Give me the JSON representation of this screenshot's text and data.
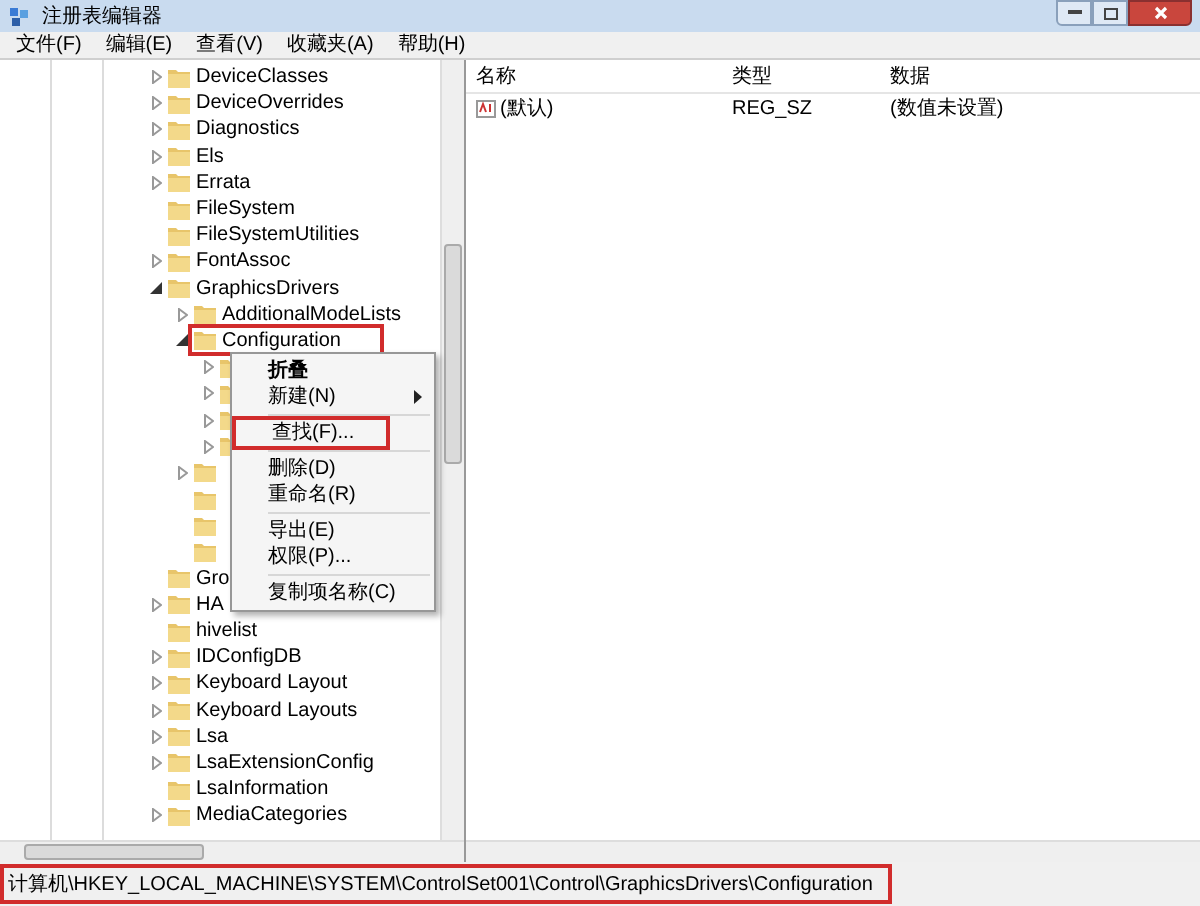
{
  "window": {
    "title": "注册表编辑器"
  },
  "menu_bar": [
    "文件(F)",
    "编辑(E)",
    "查看(V)",
    "收藏夹(A)",
    "帮助(H)"
  ],
  "tree": [
    {
      "label": "DeviceClasses",
      "expandable": true
    },
    {
      "label": "DeviceOverrides",
      "expandable": true
    },
    {
      "label": "Diagnostics",
      "expandable": true
    },
    {
      "label": "Els",
      "expandable": true
    },
    {
      "label": "Errata",
      "expandable": true
    },
    {
      "label": "FileSystem",
      "expandable": false
    },
    {
      "label": "FileSystemUtilities",
      "expandable": false
    },
    {
      "label": "FontAssoc",
      "expandable": true
    },
    {
      "label": "GraphicsDrivers",
      "expandable": true,
      "expanded": true,
      "children": [
        {
          "label": "AdditionalModeLists",
          "expandable": true
        },
        {
          "label": "Configuration",
          "expandable": true,
          "expanded": true,
          "highlighted": true,
          "children": [
            {
              "expandable": true
            },
            {
              "expandable": true
            },
            {
              "expandable": true
            },
            {
              "expandable": true
            }
          ]
        },
        {
          "expandable": true
        },
        {
          "expandable": false
        },
        {
          "expandable": false
        },
        {
          "expandable": false
        }
      ]
    },
    {
      "label": "Gro",
      "expandable": false
    },
    {
      "label": "HA",
      "expandable": true
    },
    {
      "label": "hivelist",
      "expandable": false
    },
    {
      "label": "IDConfigDB",
      "expandable": true
    },
    {
      "label": "Keyboard Layout",
      "expandable": true
    },
    {
      "label": "Keyboard Layouts",
      "expandable": true
    },
    {
      "label": "Lsa",
      "expandable": true
    },
    {
      "label": "LsaExtensionConfig",
      "expandable": true
    },
    {
      "label": "LsaInformation",
      "expandable": false
    },
    {
      "label": "MediaCategories",
      "expandable": true
    }
  ],
  "values": {
    "columns": [
      "名称",
      "类型",
      "数据"
    ],
    "rows": [
      {
        "name": "(默认)",
        "type": "REG_SZ",
        "data": "(数值未设置)"
      }
    ]
  },
  "context_menu": [
    {
      "kind": "item",
      "label": "折叠",
      "bold": true,
      "submenu": false,
      "highlighted": false
    },
    {
      "kind": "item",
      "label": "新建(N)",
      "bold": false,
      "submenu": true,
      "highlighted": false
    },
    {
      "kind": "separator"
    },
    {
      "kind": "item",
      "label": "查找(F)...",
      "bold": false,
      "submenu": false,
      "highlighted": true
    },
    {
      "kind": "separator"
    },
    {
      "kind": "item",
      "label": "删除(D)",
      "bold": false,
      "submenu": false,
      "highlighted": false
    },
    {
      "kind": "item",
      "label": "重命名(R)",
      "bold": false,
      "submenu": false,
      "highlighted": false
    },
    {
      "kind": "separator"
    },
    {
      "kind": "item",
      "label": "导出(E)",
      "bold": false,
      "submenu": false,
      "highlighted": false
    },
    {
      "kind": "item",
      "label": "权限(P)...",
      "bold": false,
      "submenu": false,
      "highlighted": false
    },
    {
      "kind": "separator"
    },
    {
      "kind": "item",
      "label": "复制项名称(C)",
      "bold": false,
      "submenu": false,
      "highlighted": false
    }
  ],
  "status_bar": {
    "path": "计算机\\HKEY_LOCAL_MACHINE\\SYSTEM\\ControlSet001\\Control\\GraphicsDrivers\\Configuration",
    "highlighted": true
  }
}
